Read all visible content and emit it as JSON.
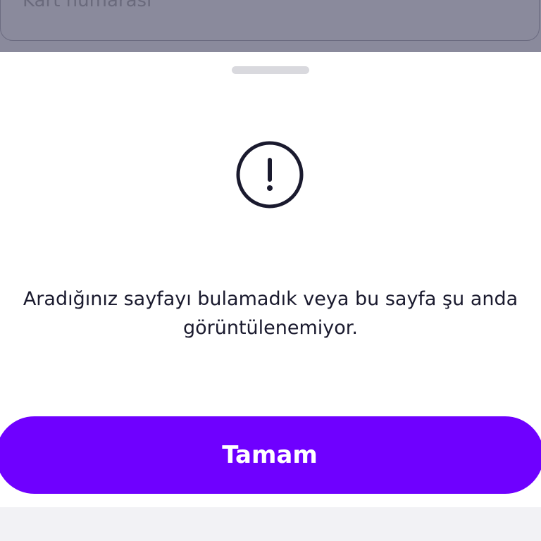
{
  "backdrop": {
    "field_placeholder": "Kart numarası"
  },
  "dialog": {
    "icon": "exclamation-circle-icon",
    "message": "Aradığınız sayfayı bulamadık veya bu sayfa şu anda görüntülenemiyor.",
    "button_label": "Tamam"
  },
  "colors": {
    "primary": "#6f00ff",
    "text": "#1a1a2e",
    "overlay": "#8a8a9c"
  }
}
